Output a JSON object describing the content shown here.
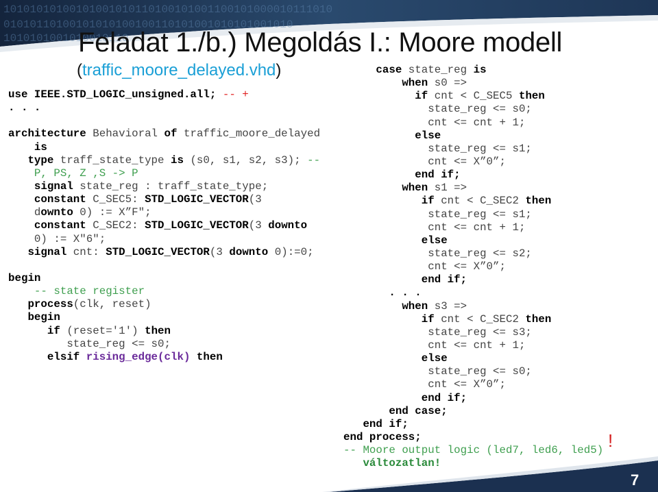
{
  "slide": {
    "title": "Feladat 1./b.) Megoldás I.: Moore modell",
    "subtitle_open": "(",
    "subtitle_file": "traffic_moore_delayed.vhd",
    "subtitle_close": ")",
    "page_number": "7",
    "note_mark": "!",
    "colors": {
      "header_band": "#1b2f4a",
      "file_link": "#1a9fd6",
      "comment": "#3f9f4f",
      "keyword": "#000000",
      "identifier": "#444444"
    }
  },
  "code_left": [
    [
      [
        "k",
        "use IEEE.STD_LOGIC_unsigned.all; "
      ],
      [
        "r",
        "-- +"
      ]
    ],
    [
      [
        "k",
        ". . ."
      ]
    ],
    [],
    [
      [
        "k",
        "architecture"
      ],
      [
        "n",
        " Behavioral "
      ],
      [
        "k",
        "of"
      ],
      [
        "n",
        " traffic_moore_delayed"
      ]
    ],
    [
      [
        "k",
        "    is"
      ]
    ],
    [
      [
        "k",
        "   type"
      ],
      [
        "n",
        " traff_state_type "
      ],
      [
        "k",
        "is"
      ],
      [
        "n",
        " (s0, s1, s2, s3); "
      ],
      [
        "c",
        "--"
      ]
    ],
    [
      [
        "c",
        "    P, PS, Z ,S -> P"
      ]
    ],
    [
      [
        "k",
        "    signal"
      ],
      [
        "n",
        " state_reg : traff_state_type;"
      ]
    ],
    [
      [
        "k",
        "    constant"
      ],
      [
        "n",
        " C_SEC5: "
      ],
      [
        "k",
        "STD_LOGIC_VECTOR"
      ],
      [
        "n",
        "(3"
      ]
    ],
    [
      [
        "n",
        "    d"
      ],
      [
        "k",
        "ownto"
      ],
      [
        "n",
        " 0) := X”F\";"
      ]
    ],
    [
      [
        "k",
        "    constant"
      ],
      [
        "n",
        " C_SEC2: "
      ],
      [
        "k",
        "STD_LOGIC_VECTOR"
      ],
      [
        "n",
        "(3 "
      ],
      [
        "k",
        "downto"
      ]
    ],
    [
      [
        "n",
        "    0) := X\"6\";"
      ]
    ],
    [
      [
        "k",
        "   signal"
      ],
      [
        "n",
        " cnt: "
      ],
      [
        "k",
        "STD_LOGIC_VECTOR"
      ],
      [
        "n",
        "(3 "
      ],
      [
        "k",
        "downto"
      ],
      [
        "n",
        " 0):=0;"
      ]
    ],
    [],
    [
      [
        "k",
        "begin"
      ]
    ],
    [
      [
        "c",
        "    -- state register"
      ]
    ],
    [
      [
        "k",
        "   process"
      ],
      [
        "n",
        "(clk, reset)"
      ]
    ],
    [
      [
        "k",
        "   begin"
      ]
    ],
    [
      [
        "k",
        "      if"
      ],
      [
        "n",
        " (reset='1') "
      ],
      [
        "k",
        "then"
      ]
    ],
    [
      [
        "n",
        "         state_reg <= s0;"
      ]
    ],
    [
      [
        "k",
        "      elsif "
      ],
      [
        "p",
        "rising_edge(clk)"
      ],
      [
        "k",
        " then"
      ]
    ]
  ],
  "code_right": [
    [
      [
        "k",
        "     case"
      ],
      [
        "n",
        " state_reg "
      ],
      [
        "k",
        "is"
      ]
    ],
    [
      [
        "k",
        "         when"
      ],
      [
        "n",
        " s0 =>"
      ]
    ],
    [
      [
        "k",
        "           if"
      ],
      [
        "n",
        " cnt < C_SEC5 "
      ],
      [
        "k",
        "then"
      ]
    ],
    [
      [
        "n",
        "             state_reg <= s0;"
      ]
    ],
    [
      [
        "n",
        "             cnt <= cnt + 1;"
      ]
    ],
    [
      [
        "k",
        "           else"
      ]
    ],
    [
      [
        "n",
        "             state_reg <= s1;"
      ]
    ],
    [
      [
        "n",
        "             cnt <= X”0”;"
      ]
    ],
    [
      [
        "k",
        "           end if;"
      ]
    ],
    [
      [
        "k",
        "         when"
      ],
      [
        "n",
        " s1 =>"
      ]
    ],
    [
      [
        "k",
        "            if"
      ],
      [
        "n",
        " cnt < C_SEC2 "
      ],
      [
        "k",
        "then"
      ]
    ],
    [
      [
        "n",
        "             state_reg <= s1;"
      ]
    ],
    [
      [
        "n",
        "             cnt <= cnt + 1;"
      ]
    ],
    [
      [
        "k",
        "            else"
      ]
    ],
    [
      [
        "n",
        "             state_reg <= s2;"
      ]
    ],
    [
      [
        "n",
        "             cnt <= X”0”;"
      ]
    ],
    [
      [
        "k",
        "            end if;"
      ]
    ],
    [
      [
        "k",
        "       . . ."
      ]
    ],
    [
      [
        "k",
        "         when"
      ],
      [
        "n",
        " s3 =>"
      ]
    ],
    [
      [
        "k",
        "            if"
      ],
      [
        "n",
        " cnt < C_SEC2 "
      ],
      [
        "k",
        "then"
      ]
    ],
    [
      [
        "n",
        "             state_reg <= s3;"
      ]
    ],
    [
      [
        "n",
        "             cnt <= cnt + 1;"
      ]
    ],
    [
      [
        "k",
        "            else"
      ]
    ],
    [
      [
        "n",
        "             state_reg <= s0;"
      ]
    ],
    [
      [
        "n",
        "             cnt <= X”0”;"
      ]
    ],
    [
      [
        "k",
        "            end if;"
      ]
    ],
    [
      [
        "k",
        "       end case;"
      ]
    ],
    [
      [
        "k",
        "   end if;"
      ]
    ],
    [
      [
        "k",
        "end process;"
      ]
    ],
    [
      [
        "c",
        "-- Moore output logic (led7, led6, led5)"
      ]
    ],
    [
      [
        "ck",
        "   változatlan!"
      ]
    ]
  ]
}
